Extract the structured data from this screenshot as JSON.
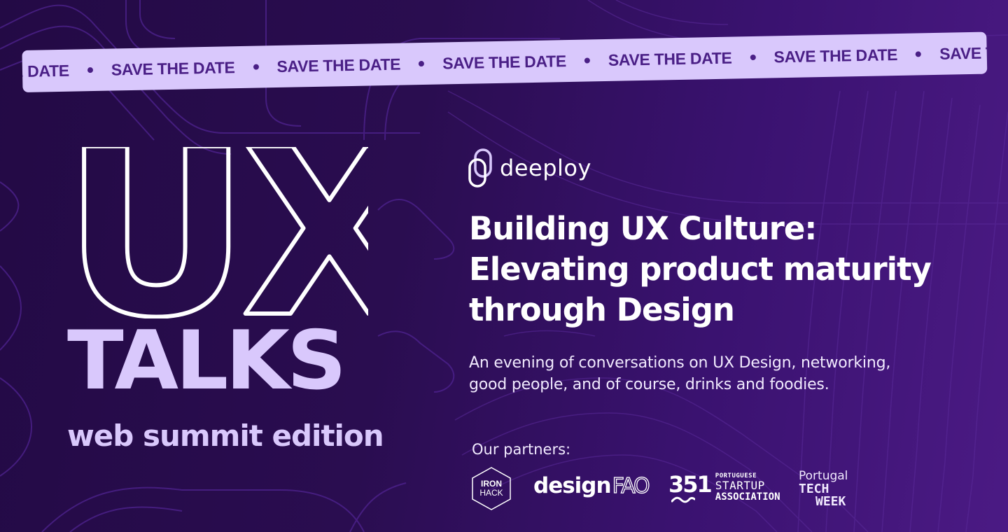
{
  "banner": {
    "ribbon_text": "SAVE THE DATE",
    "ribbon_leading_fragment": "E DATE",
    "ribbon_trailing_fragment": "SAVE TH",
    "ribbon_repeat_count": 5
  },
  "event": {
    "title_outline": "UX",
    "title_solid": "TALKS",
    "edition": "web summit edition"
  },
  "host": {
    "brand_name": "deeploy",
    "headline_lines": [
      "Building UX Culture:",
      "Elevating product maturity",
      "through Design"
    ],
    "description_lines": [
      "An evening of conversations on UX Design, networking,",
      "good people, and of course, drinks and foodies."
    ]
  },
  "partners": {
    "label": "Our partners:",
    "ironhack": {
      "line1": "IRON",
      "line2": "HACK"
    },
    "designfao": {
      "name": "design",
      "suffix": "FAO"
    },
    "psa": {
      "number": "351",
      "line1": "PORTUGUESE",
      "line2": "STARTUP",
      "line3": "ASSOCIATION"
    },
    "ptw": {
      "line1": "Portugal",
      "line2": "TECH",
      "line3": "WEEK"
    }
  },
  "colors": {
    "background_dark": "#230a45",
    "background_light": "#4b1a84",
    "accent_lilac": "#d9c8fc",
    "ribbon_text": "#4a1f86",
    "contour_line": "#5a2a9a"
  }
}
